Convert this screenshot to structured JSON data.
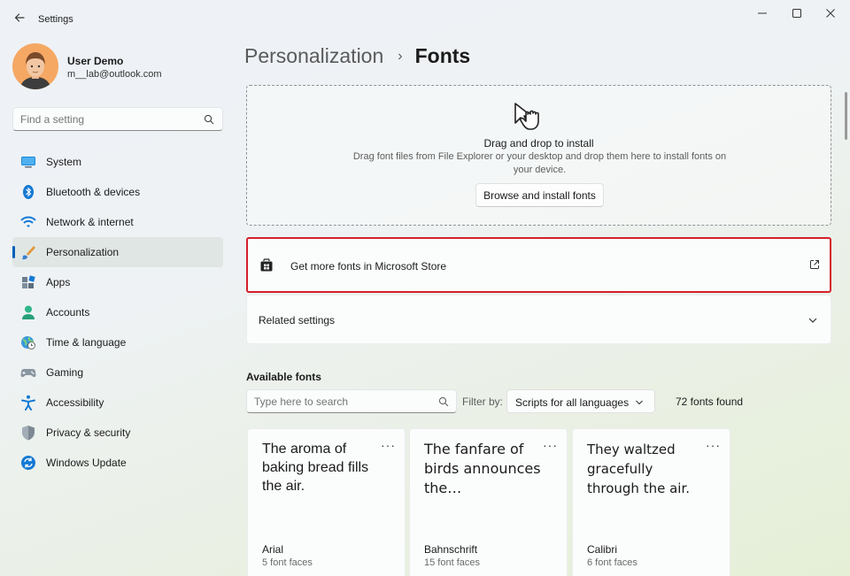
{
  "window": {
    "title": "Settings",
    "controls": [
      "minimize",
      "maximize",
      "close"
    ]
  },
  "user": {
    "name": "User Demo",
    "email": "m__lab@outlook.com"
  },
  "sidebar": {
    "search_placeholder": "Find a setting",
    "items": [
      {
        "label": "System",
        "icon": "system-icon"
      },
      {
        "label": "Bluetooth & devices",
        "icon": "bluetooth-icon"
      },
      {
        "label": "Network & internet",
        "icon": "wifi-icon"
      },
      {
        "label": "Personalization",
        "icon": "brush-icon",
        "active": true
      },
      {
        "label": "Apps",
        "icon": "apps-icon"
      },
      {
        "label": "Accounts",
        "icon": "accounts-icon"
      },
      {
        "label": "Time & language",
        "icon": "globe-clock-icon"
      },
      {
        "label": "Gaming",
        "icon": "gamepad-icon"
      },
      {
        "label": "Accessibility",
        "icon": "accessibility-icon"
      },
      {
        "label": "Privacy & security",
        "icon": "shield-icon"
      },
      {
        "label": "Windows Update",
        "icon": "update-icon"
      }
    ]
  },
  "breadcrumb": {
    "parent": "Personalization",
    "separator": "›",
    "current": "Fonts"
  },
  "dropzone": {
    "title": "Drag and drop to install",
    "description": "Drag font files from File Explorer or your desktop and drop them here to install fonts on your device.",
    "button_label": "Browse and install fonts"
  },
  "store_link": {
    "label": "Get more fonts in Microsoft Store",
    "highlight_color": "#d4202c"
  },
  "related_settings": {
    "label": "Related settings"
  },
  "available_fonts": {
    "title": "Available fonts",
    "search_placeholder": "Type here to search",
    "filter_label": "Filter by:",
    "filter_value": "Scripts for all languages",
    "count_text": "72 fonts found",
    "fonts": [
      {
        "sample": "The aroma of baking bread fills the air.",
        "name": "Arial",
        "faces": "5 font faces"
      },
      {
        "sample": "The fanfare of birds announces the…",
        "name": "Bahnschrift",
        "faces": "15 font faces"
      },
      {
        "sample": "They waltzed gracefully through the air.",
        "name": "Calibri",
        "faces": "6 font faces"
      }
    ]
  },
  "colors": {
    "accent": "#005fb8",
    "highlight": "#d4202c"
  }
}
